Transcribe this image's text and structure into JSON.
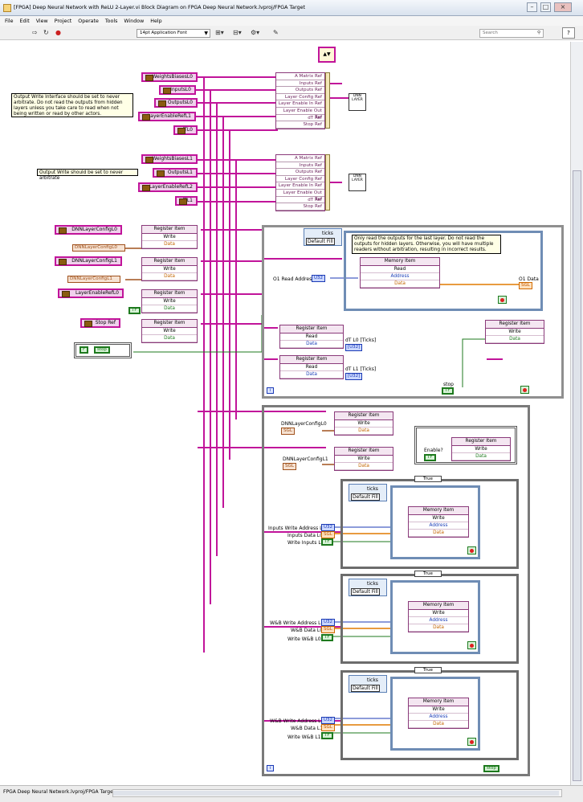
{
  "window": {
    "title": "[FPGA] Deep Neural Network with ReLU 2-Layer.vi Block Diagram on FPGA Deep Neural Network.lvproj/FPGA Target",
    "controls": {
      "minimize": "–",
      "maximize": "□",
      "close": "×"
    }
  },
  "menu": [
    "File",
    "Edit",
    "View",
    "Project",
    "Operate",
    "Tools",
    "Window",
    "Help"
  ],
  "toolbar": {
    "font_selector": "14pt Application Font",
    "search_placeholder": "Search",
    "icons": [
      "run-arrow-icon",
      "highlight-execution-icon",
      "abort-icon",
      "pause-icon",
      "align-objects-icon",
      "distribute-objects-icon",
      "resize-objects-icon",
      "reorder-icon",
      "search-icon",
      "help-icon"
    ]
  },
  "diagram": {
    "refs_layer0": [
      "WeightsBiasesL0",
      "InputsL0",
      "OutputsL0",
      "LayerEnableRefL1",
      "dTL0"
    ],
    "refs_layer1": [
      "WeightsBiasesL1",
      "OutputsL1",
      "LayerEnableRefL2",
      "dTL1"
    ],
    "note_layer0": "Output Write Interface should be set to never arbitrate. Do not read the outputs from hidden layers unless you take care to read when not being written or read by other actors.",
    "note_layer1": "Output Write should be set to never arbitrate",
    "bundle_fields": [
      "A Matrix Ref",
      "Inputs Ref",
      "Outputs Ref",
      "Layer Config Ref",
      "Layer Enable In Ref",
      "Layer Enable Out Ref",
      "dT Ref",
      "Stop Ref"
    ],
    "dnn_icon_text": "DNN LAYER",
    "config_refs": [
      "DNNLayerConfigL0",
      "DNNLayerConfigL1",
      "LayerEnableRefL0",
      "Stop Ref"
    ],
    "config_constants": [
      "DNNLayerConfigL0",
      "DNNLayerConfigL1"
    ],
    "register_item": {
      "title": "Register Item",
      "write": "Write",
      "read": "Read",
      "data": "Data"
    },
    "memory_item": {
      "title": "Memory Item",
      "read": "Read",
      "write": "Write",
      "address": "Address",
      "data": "Data"
    },
    "timed_loop": {
      "source": "ticks",
      "default": "Default Fill"
    },
    "read_note": "Only read the outputs for the last layer. Do not read the outputs for hidden layers. Otherwise, you will have multiple readers without arbitration, resulting in incorrect results.",
    "labels": {
      "o1_read_address": "O1 Read Address",
      "o1_data": "O1 Data",
      "dt_l0": "dT L0 [Ticks]",
      "dt_l1": "dT L1 [Ticks]",
      "stop": "stop",
      "enable": "Enable?",
      "inputs_write_address": "Inputs Write Address L0",
      "inputs_data": "Inputs Data L0",
      "write_inputs": "Write Inputs L0",
      "wb_write_address_l0": "W&B Write Address L0",
      "wb_data_l0": "W&B Data L0",
      "write_wb_l0": "Write W&B L0",
      "wb_write_address_l1": "W&B Write Address L1",
      "wb_data_l1": "W&B Data L1",
      "write_wb_l1": "Write W&B L1"
    },
    "type_tags": {
      "u32": "U32",
      "sgl": "SGL",
      "tf": "TF",
      "u32_array": "[U32]",
      "tf_const": "F"
    },
    "case_selector": "True",
    "iteration_terminal": "i"
  },
  "status": {
    "project_path": "FPGA Deep Neural Network.lvproj/FPGA Target"
  },
  "colors": {
    "ref_wire": "#c1149a",
    "u32": "#1b3ab5",
    "sgl": "#e07a00",
    "bool": "#1e7a1e",
    "cluster": "#a0521d"
  }
}
